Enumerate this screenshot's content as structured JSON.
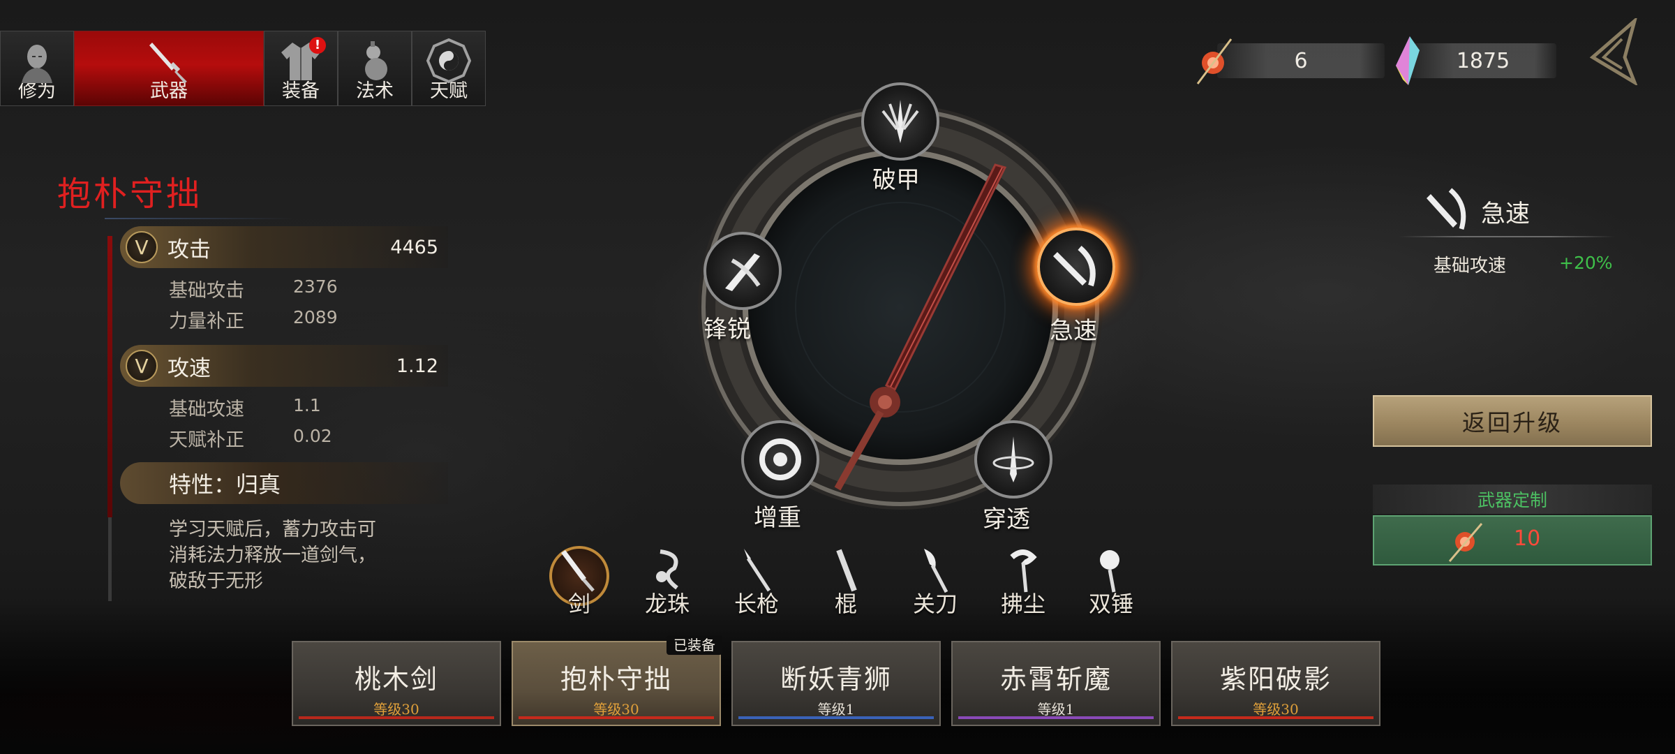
{
  "tabs": [
    {
      "label": "修为",
      "icon": "monk-head-icon",
      "active": false
    },
    {
      "label": "武器",
      "icon": "sword-icon",
      "active": true
    },
    {
      "label": "装备",
      "icon": "robe-icon",
      "active": false,
      "badge": "!"
    },
    {
      "label": "法术",
      "icon": "gourd-icon",
      "active": false
    },
    {
      "label": "天赋",
      "icon": "bagua-icon",
      "active": false
    }
  ],
  "currency": {
    "spirit_orb": "6",
    "crystal": "1875"
  },
  "weapon": {
    "name": "抱朴守拙",
    "attack": {
      "label": "攻击",
      "value": "4465",
      "rows": [
        {
          "label": "基础攻击",
          "value": "2376"
        },
        {
          "label": "力量补正",
          "value": "2089"
        }
      ]
    },
    "speed": {
      "label": "攻速",
      "value": "1.12",
      "rows": [
        {
          "label": "基础攻速",
          "value": "1.1"
        },
        {
          "label": "天赋补正",
          "value": "0.02"
        }
      ]
    },
    "trait_title": "特性：归真",
    "trait_desc": "学习天赋后，蓄力攻击可消耗法力释放一道剑气，破敌于无形"
  },
  "wheel": {
    "nodes": [
      {
        "label": "破甲",
        "selected": false
      },
      {
        "label": "锋锐",
        "selected": false
      },
      {
        "label": "急速",
        "selected": true
      },
      {
        "label": "增重",
        "selected": false
      },
      {
        "label": "穿透",
        "selected": false
      }
    ]
  },
  "info": {
    "title": "急速",
    "stat_label": "基础攻速",
    "stat_value": "+20%"
  },
  "buttons": {
    "return_label": "返回升级",
    "custom_label": "武器定制",
    "custom_cost": "10"
  },
  "weapon_types": [
    {
      "label": "剑",
      "selected": true
    },
    {
      "label": "龙珠",
      "selected": false
    },
    {
      "label": "长枪",
      "selected": false
    },
    {
      "label": "棍",
      "selected": false
    },
    {
      "label": "关刀",
      "selected": false
    },
    {
      "label": "拂尘",
      "selected": false
    },
    {
      "label": "双锤",
      "selected": false
    }
  ],
  "weapon_cards": [
    {
      "name": "桃木剑",
      "level": "等级30",
      "level_color": "#e0a03a",
      "bar_color": "#b8281c"
    },
    {
      "name": "抱朴守拙",
      "level": "等级30",
      "level_color": "#e0a03a",
      "bar_color": "#c62a1c"
    },
    {
      "name": "断妖青狮",
      "level": "等级1",
      "level_color": "#e6e0d6",
      "bar_color": "#3a62b8"
    },
    {
      "name": "赤霄斩魔",
      "level": "等级1",
      "level_color": "#e6e0d6",
      "bar_color": "#8a4ab8"
    },
    {
      "name": "紫阳破影",
      "level": "等级30",
      "level_color": "#e0a03a",
      "bar_color": "#c62a1c"
    }
  ],
  "equipped_tag": "已装备"
}
